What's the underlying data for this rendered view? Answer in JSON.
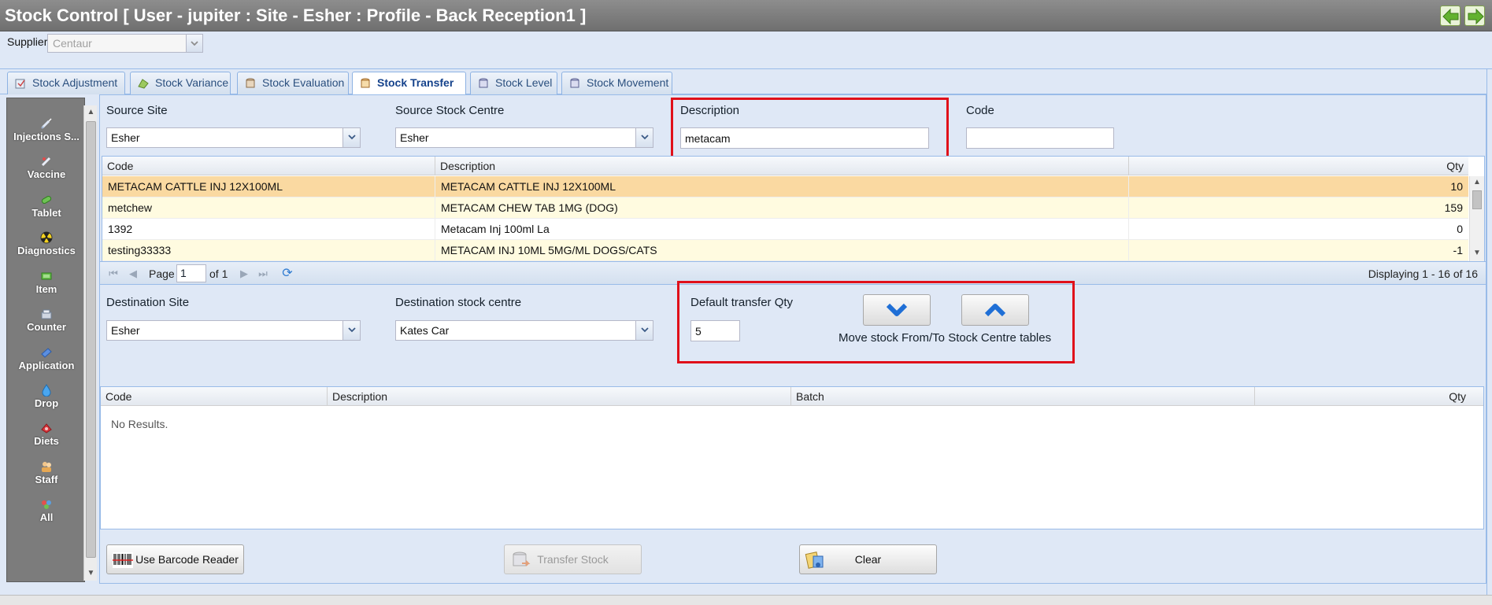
{
  "window": {
    "title": "Stock Control [ User - jupiter : Site - Esher : Profile - Back Reception1 ]",
    "back_icon": "green-left-arrow-icon",
    "forward_icon": "green-right-arrow-icon"
  },
  "supplier": {
    "label": "Supplier",
    "value": "Centaur"
  },
  "tabs": [
    {
      "label": "Stock Adjustment",
      "icon": "adjustment-icon"
    },
    {
      "label": "Stock Variance",
      "icon": "variance-icon"
    },
    {
      "label": "Stock Evaluation",
      "icon": "evaluation-icon"
    },
    {
      "label": "Stock Transfer",
      "icon": "transfer-icon",
      "active": true
    },
    {
      "label": "Stock Level",
      "icon": "level-icon"
    },
    {
      "label": "Stock Movement",
      "icon": "movement-icon"
    }
  ],
  "sidebar": {
    "items": [
      {
        "label": "Injections S...",
        "icon": "syringe-icon"
      },
      {
        "label": "Vaccine",
        "icon": "vaccine-icon"
      },
      {
        "label": "Tablet",
        "icon": "tablet-icon"
      },
      {
        "label": "Diagnostics",
        "icon": "radiation-icon"
      },
      {
        "label": "Item",
        "icon": "item-icon"
      },
      {
        "label": "Counter",
        "icon": "counter-icon"
      },
      {
        "label": "Application",
        "icon": "application-icon"
      },
      {
        "label": "Drop",
        "icon": "drop-icon"
      },
      {
        "label": "Diets",
        "icon": "diets-icon"
      },
      {
        "label": "Staff",
        "icon": "staff-icon"
      },
      {
        "label": "All",
        "icon": "all-icon"
      }
    ]
  },
  "source": {
    "site_label": "Source Site",
    "site_value": "Esher",
    "centre_label": "Source Stock Centre",
    "centre_value": "Esher",
    "description_label": "Description",
    "description_value": "metacam",
    "code_label": "Code",
    "code_value": ""
  },
  "source_grid": {
    "columns": [
      "Code",
      "Description",
      "Qty"
    ],
    "rows": [
      {
        "code": "METACAM CATTLE INJ 12X100ML",
        "description": "METACAM CATTLE INJ 12X100ML",
        "qty": "10",
        "state": "selected"
      },
      {
        "code": "metchew",
        "description": "METACAM CHEW TAB 1MG (DOG)",
        "qty": "159",
        "state": "alt"
      },
      {
        "code": "1392",
        "description": "Metacam Inj 100ml La",
        "qty": "0",
        "state": "normal"
      },
      {
        "code": "testing33333",
        "description": "METACAM INJ 10ML 5MG/ML DOGS/CATS",
        "qty": "-1",
        "state": "alt"
      }
    ]
  },
  "paging": {
    "page_label": "Page",
    "page_value": "1",
    "of_label": "of 1",
    "display_text": "Displaying 1 - 16 of 16"
  },
  "destination": {
    "site_label": "Destination Site",
    "site_value": "Esher",
    "centre_label": "Destination stock centre",
    "centre_value": "Kates Car",
    "qty_label": "Default transfer Qty",
    "qty_value": "5",
    "move_caption": "Move stock From/To Stock Centre tables"
  },
  "dest_grid": {
    "columns": [
      "Code",
      "Description",
      "Batch",
      "Qty"
    ],
    "empty_text": "No Results."
  },
  "buttons": {
    "barcode": "Use Barcode Reader",
    "transfer": "Transfer Stock",
    "clear": "Clear"
  },
  "colors": {
    "highlight": "#e0101a",
    "selected_row": "#fad9a1",
    "alt_row": "#fffbe0",
    "panel_bg": "#dfe8f6"
  }
}
